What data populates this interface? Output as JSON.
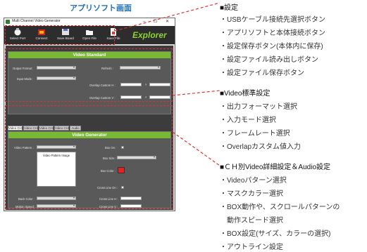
{
  "caption": "アプリソフト画面",
  "window": {
    "title": "Multi Channel Video Generator",
    "controls": "‒ ☐ ✕"
  },
  "toolbar": {
    "items": [
      {
        "label": "Select Port",
        "icon": "port-icon"
      },
      {
        "label": "Connect",
        "icon": "connect-icon"
      },
      {
        "label": "Save Board",
        "icon": "save-board-icon"
      },
      {
        "label": "Open File",
        "icon": "open-file-icon"
      },
      {
        "label": "Save File",
        "icon": "save-file-icon"
      }
    ],
    "logo": "Explorer"
  },
  "video_standard": {
    "header": "Video Standard",
    "output_format": "Output Format :",
    "input_mode": "Input Mode :",
    "refresh": "Refresh :",
    "overlap_h": "Overlap Custom H :",
    "overlap_v": "Overlap Custom V :",
    "x_sep_1": "×",
    "x_sep_2": "×"
  },
  "tabs": [
    "Video CH1",
    "Video CH2",
    "Video CH3",
    "Video CH4",
    "Audio"
  ],
  "video_generator": {
    "header": "Video Generator",
    "video_pattern": "Video Pattern :",
    "video_pattern_image": "Video Pattern Image",
    "box_on": "Box On :",
    "box_size": "Box Size :",
    "box_color": "Box Color :",
    "cross_line_on": "Cross Line On :",
    "back_color": "Back Color :",
    "cross_line_h": "Cross Line H :",
    "motion_speed": "Motion Speed :",
    "cross_line_v": "Cross Line V :",
    "box_color_value": "#e8201e"
  },
  "annotations": {
    "settings": {
      "title": "■設定",
      "items": [
        "・USBケーブル接続先選択ボタン",
        "・アプリソフトと本体接続ボタン",
        "・設定保存ボタン(本体内に保存)",
        "・設定ファイル読み出しボタン",
        "・設定ファイル保存ボタン"
      ]
    },
    "video_standard": {
      "title": "■Video標準設定",
      "items": [
        "・出力フォーマット選択",
        "・入力モード選択",
        "・フレームレート選択",
        "・Overlapカスタム値入力"
      ]
    },
    "ch_settings": {
      "title": "■ＣＨ別Video詳細設定＆Audio設定",
      "items": [
        "・Videoパターン選択",
        "・マスクカラー選択",
        "・BOX動作や、スクロールパターンの",
        "　動作スピード選択",
        "・BOX設定(サイズ、カラーの選択)",
        "・アウトライン設定"
      ]
    }
  },
  "colors": {
    "accent_green": "#78b832",
    "highlight_red": "#e0302e",
    "caption_blue": "#1f6fb5"
  }
}
